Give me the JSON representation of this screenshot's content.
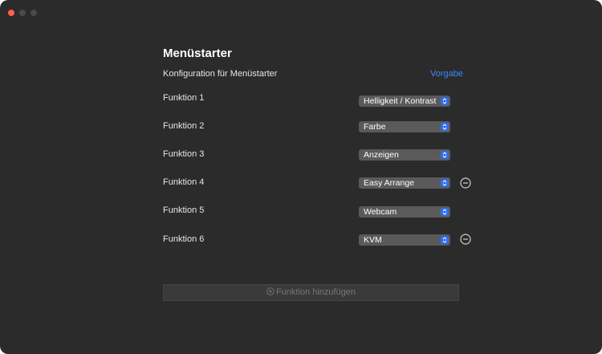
{
  "panel": {
    "title": "Menüstarter",
    "subtitle": "Konfiguration für Menüstarter",
    "default_link": "Vorgabe"
  },
  "functions": [
    {
      "label": "Funktion 1",
      "value": "Helligkeit / Kontrast",
      "removable": false
    },
    {
      "label": "Funktion 2",
      "value": "Farbe",
      "removable": false
    },
    {
      "label": "Funktion 3",
      "value": "Anzeigen",
      "removable": false
    },
    {
      "label": "Funktion 4",
      "value": "Easy Arrange",
      "removable": true
    },
    {
      "label": "Funktion 5",
      "value": "Webcam",
      "removable": false
    },
    {
      "label": "Funktion 6",
      "value": "KVM",
      "removable": true
    }
  ],
  "add_button": {
    "label": "Funktion hinzufügen",
    "enabled": false
  },
  "colors": {
    "window_bg": "#2b2b2b",
    "accent": "#3b8bff",
    "select_bg": "#5a5a5a",
    "stepper_blue": "#2f6ee9",
    "close_red": "#ff5f57"
  },
  "icons": {
    "window_controls": [
      "close-icon",
      "minimize-icon",
      "maximize-icon"
    ],
    "select_indicator": "chevron-up-down-icon",
    "remove": "minus-circle-icon",
    "add": "plus-circle-icon"
  }
}
